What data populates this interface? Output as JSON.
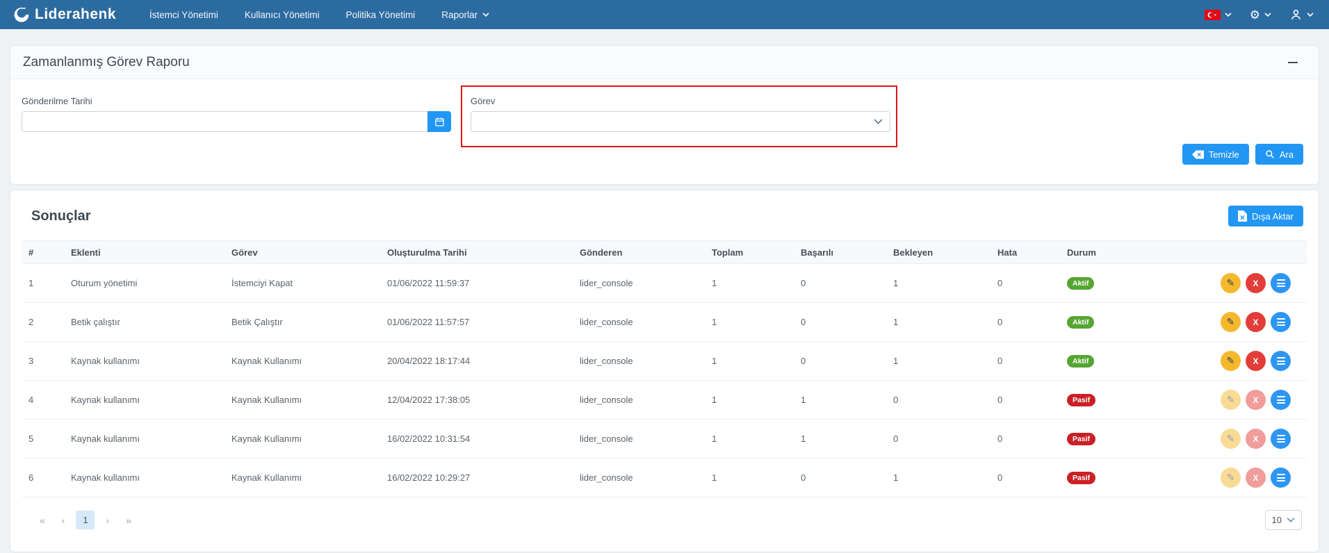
{
  "colors": {
    "navbar_bg": "#2c6ba0",
    "primary": "#2196f3",
    "annotation_red": "#e01414",
    "status": {
      "Aktif": "#55a532",
      "Pasif": "#cb2026"
    },
    "action_buttons": {
      "edit": "#f5b82d",
      "delete": "#e33d39",
      "detail": "#2d96f3"
    }
  },
  "navbar": {
    "brand": "Liderahenk",
    "items": [
      {
        "label": "İstemci Yönetimi"
      },
      {
        "label": "Kullanıcı Yönetimi"
      },
      {
        "label": "Politika Yönetimi"
      },
      {
        "label": "Raporlar"
      }
    ],
    "right_icons": [
      "turkish-flag-icon",
      "settings-gear-icon",
      "user-icon"
    ]
  },
  "filter_panel": {
    "title": "Zamanlanmış Görev Raporu",
    "date_field": {
      "label": "Gönderilme Tarihi",
      "value": ""
    },
    "task_field": {
      "label": "Görev",
      "value": ""
    },
    "clear_button": "Temizle",
    "search_button": "Ara"
  },
  "results": {
    "title": "Sonuçlar",
    "export_button": "Dışa Aktar",
    "table": {
      "columns": [
        "#",
        "Eklenti",
        "Görev",
        "Oluşturulma Tarihi",
        "Gönderen",
        "Toplam",
        "Başarılı",
        "Bekleyen",
        "Hata",
        "Durum"
      ],
      "rows": [
        {
          "no": "1",
          "plugin": "Oturum yönetimi",
          "task": "İstemciyi Kapat",
          "created": "01/06/2022 11:59:37",
          "sender": "lider_console",
          "total": "1",
          "success": "0",
          "waiting": "1",
          "error": "0",
          "status": "Aktif"
        },
        {
          "no": "2",
          "plugin": "Betik çalıştır",
          "task": "Betik Çalıştır",
          "created": "01/06/2022 11:57:57",
          "sender": "lider_console",
          "total": "1",
          "success": "0",
          "waiting": "1",
          "error": "0",
          "status": "Aktif"
        },
        {
          "no": "3",
          "plugin": "Kaynak kullanımı",
          "task": "Kaynak Kullanımı",
          "created": "20/04/2022 18:17:44",
          "sender": "lider_console",
          "total": "1",
          "success": "0",
          "waiting": "1",
          "error": "0",
          "status": "Aktif"
        },
        {
          "no": "4",
          "plugin": "Kaynak kullanımı",
          "task": "Kaynak Kullanımı",
          "created": "12/04/2022 17:38:05",
          "sender": "lider_console",
          "total": "1",
          "success": "1",
          "waiting": "0",
          "error": "0",
          "status": "Pasif"
        },
        {
          "no": "5",
          "plugin": "Kaynak kullanımı",
          "task": "Kaynak Kullanımı",
          "created": "16/02/2022 10:31:54",
          "sender": "lider_console",
          "total": "1",
          "success": "1",
          "waiting": "0",
          "error": "0",
          "status": "Pasif"
        },
        {
          "no": "6",
          "plugin": "Kaynak kullanımı",
          "task": "Kaynak Kullanımı",
          "created": "16/02/2022 10:29:27",
          "sender": "lider_console",
          "total": "1",
          "success": "0",
          "waiting": "1",
          "error": "0",
          "status": "Pasif"
        }
      ]
    },
    "pagination": {
      "first": "«",
      "prev": "‹",
      "current_page": "1",
      "next": "›",
      "last": "»",
      "page_size": "10"
    }
  }
}
